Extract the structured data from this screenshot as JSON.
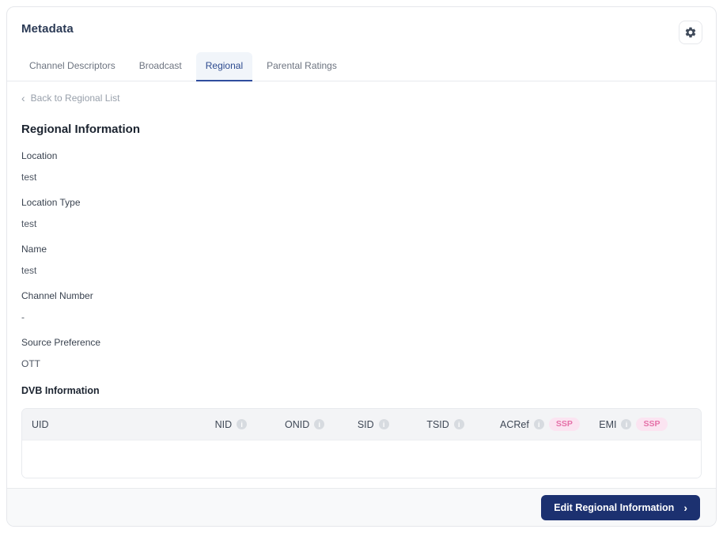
{
  "header": {
    "title": "Metadata",
    "settings_icon": "gear-icon"
  },
  "tabs": [
    {
      "label": "Channel Descriptors",
      "active": false
    },
    {
      "label": "Broadcast",
      "active": false
    },
    {
      "label": "Regional",
      "active": true
    },
    {
      "label": "Parental Ratings",
      "active": false
    }
  ],
  "back_link": {
    "chevron": "‹",
    "label": "Back to Regional List"
  },
  "regional_info": {
    "title": "Regional Information",
    "fields": [
      {
        "label": "Location",
        "value": "test"
      },
      {
        "label": "Location Type",
        "value": "test"
      },
      {
        "label": "Name",
        "value": "test"
      },
      {
        "label": "Channel Number",
        "value": "-"
      },
      {
        "label": "Source Preference",
        "value": "OTT"
      }
    ]
  },
  "dvb": {
    "title": "DVB Information",
    "info_glyph": "i",
    "columns": [
      {
        "label": "UID",
        "info": false,
        "badge": null
      },
      {
        "label": "NID",
        "info": true,
        "badge": null
      },
      {
        "label": "ONID",
        "info": true,
        "badge": null
      },
      {
        "label": "SID",
        "info": true,
        "badge": null
      },
      {
        "label": "TSID",
        "info": true,
        "badge": null
      },
      {
        "label": "ACRef",
        "info": true,
        "badge": "SSP"
      },
      {
        "label": "EMI",
        "info": true,
        "badge": "SSP"
      }
    ],
    "rows": []
  },
  "footer": {
    "edit_button": {
      "label": "Edit Regional Information",
      "chevron": "›"
    }
  },
  "colors": {
    "accent_navy": "#1c3170",
    "tab_active_text": "#2c4a8f",
    "tab_active_bg": "#f1f5fa",
    "tab_underline": "#2f4d9e",
    "badge_bg": "#fbe4f1",
    "badge_text": "#e570a8",
    "table_header_bg": "#f3f4f6",
    "border": "#e5e7eb"
  }
}
